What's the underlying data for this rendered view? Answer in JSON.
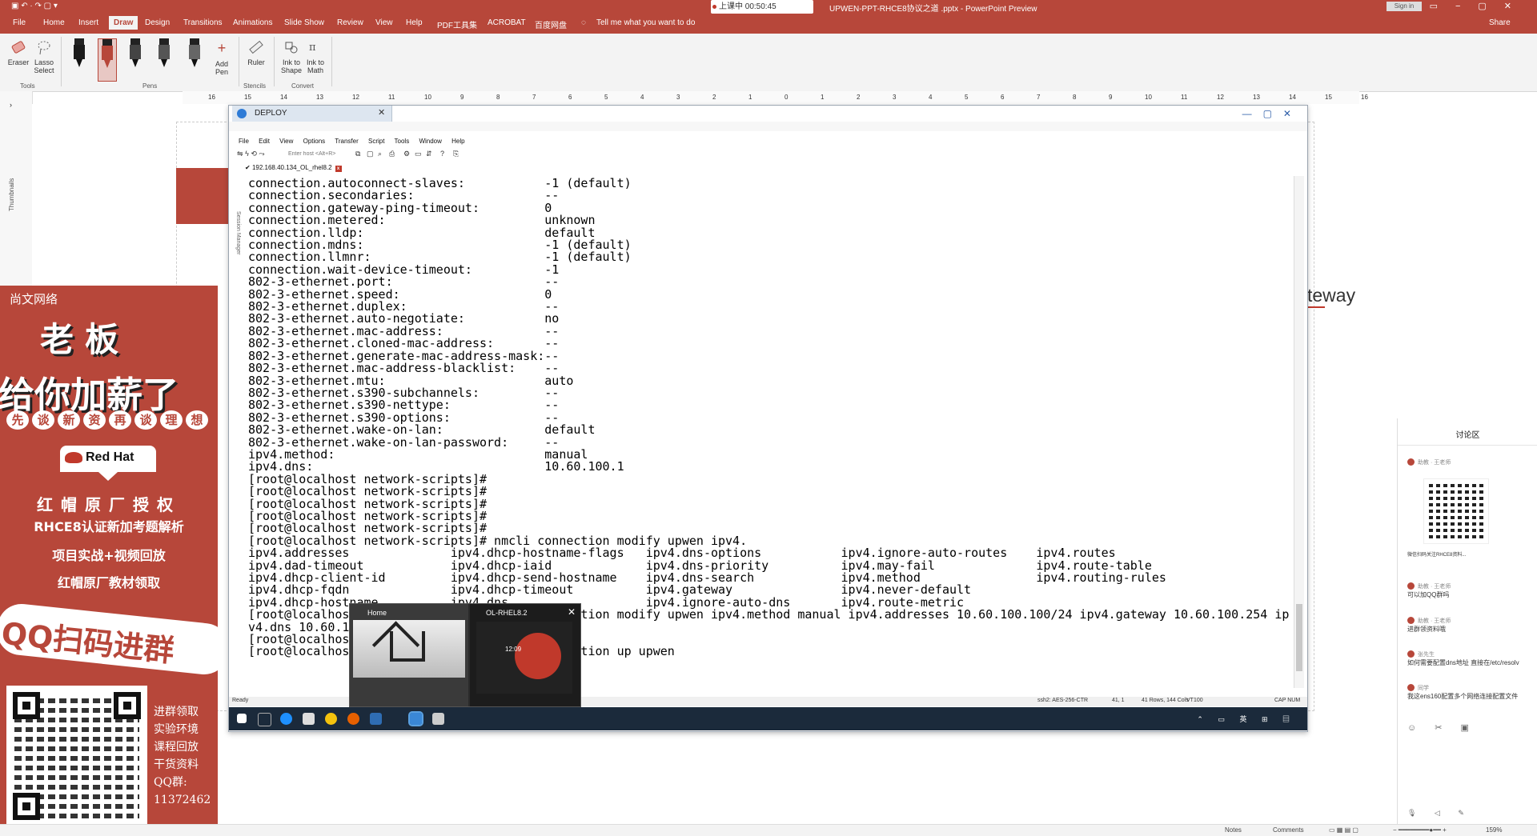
{
  "ppt": {
    "window_title": "UPWEN-PPT-RHCE8协议之道 .pptx - PowerPoint Preview",
    "recording": "上课中 00:50:45",
    "tell_me": "Tell me what you want to do",
    "share": "Share",
    "tabs": [
      "File",
      "Home",
      "Insert",
      "Draw",
      "Design",
      "Transitions",
      "Animations",
      "Slide Show",
      "Review",
      "View",
      "Help",
      "PDF工具集",
      "ACROBAT",
      "百度网盘"
    ],
    "active_tab": "Draw",
    "ribbon": {
      "eraser": "Eraser",
      "lasso": "Lasso Select",
      "tools_group": "Tools",
      "add_pen": "Add Pen",
      "pens_group": "Pens",
      "ruler": "Ruler",
      "stencils_group": "Stencils",
      "ink_to_shape": "Ink to Shape",
      "ink_to_math": "Ink to Math",
      "convert_group": "Convert"
    },
    "ruler_numbers": [
      "16",
      "15",
      "14",
      "13",
      "12",
      "11",
      "10",
      "9",
      "8",
      "7",
      "6",
      "5",
      "4",
      "3",
      "2",
      "1",
      "0",
      "1",
      "2",
      "3",
      "4",
      "5",
      "6",
      "7",
      "8",
      "9",
      "10",
      "11",
      "12",
      "13",
      "14",
      "15",
      "16"
    ],
    "thumbnails_label": "Thumbnails",
    "slide_text": "teway",
    "status": {
      "notes": "Notes",
      "comments": "Comments",
      "zoom": "159%"
    }
  },
  "ad": {
    "brand": "尚文网络",
    "line1": "老板",
    "line2": "给你加薪了",
    "strip": [
      "先",
      "谈",
      "新",
      "资",
      "再",
      "谈",
      "理",
      "想"
    ],
    "redhat": "Red Hat",
    "auth": "红帽原厂授权",
    "l1": "RHCE8认证新加考题解析",
    "l2": "项目实战+视频回放",
    "l3": "红帽原厂教材领取",
    "qq": "QQ扫码进群",
    "side": [
      "进群领取",
      "实验环境",
      "课程回放",
      "干货资料",
      "QQ群:",
      "11372462"
    ]
  },
  "crt": {
    "tab_title": "DEPLOY",
    "menu": [
      "File",
      "Edit",
      "View",
      "Options",
      "Transfer",
      "Script",
      "Tools",
      "Window",
      "Help"
    ],
    "host_placeholder": "Enter host <Alt+R>",
    "session_tab": "192.168.40.134_OL_rhel8.2",
    "session_manager": "Session Manager",
    "terminal_lines": [
      "connection.autoconnect-slaves:           -1 (default)",
      "connection.secondaries:                  --",
      "connection.gateway-ping-timeout:         0",
      "connection.metered:                      unknown",
      "connection.lldp:                         default",
      "connection.mdns:                         -1 (default)",
      "connection.llmnr:                        -1 (default)",
      "connection.wait-device-timeout:          -1",
      "802-3-ethernet.port:                     --",
      "802-3-ethernet.speed:                    0",
      "802-3-ethernet.duplex:                   --",
      "802-3-ethernet.auto-negotiate:           no",
      "802-3-ethernet.mac-address:              --",
      "802-3-ethernet.cloned-mac-address:       --",
      "802-3-ethernet.generate-mac-address-mask:--",
      "802-3-ethernet.mac-address-blacklist:    --",
      "802-3-ethernet.mtu:                      auto",
      "802-3-ethernet.s390-subchannels:         --",
      "802-3-ethernet.s390-nettype:             --",
      "802-3-ethernet.s390-options:             --",
      "802-3-ethernet.wake-on-lan:              default",
      "802-3-ethernet.wake-on-lan-password:     --",
      "ipv4.method:                             manual",
      "ipv4.dns:                                10.60.100.1",
      "[root@localhost network-scripts]#",
      "[root@localhost network-scripts]#",
      "[root@localhost network-scripts]#",
      "[root@localhost network-scripts]#",
      "[root@localhost network-scripts]#",
      "[root@localhost network-scripts]# nmcli connection modify upwen ipv4.",
      "ipv4.addresses              ipv4.dhcp-hostname-flags   ipv4.dns-options           ipv4.ignore-auto-routes    ipv4.routes",
      "ipv4.dad-timeout            ipv4.dhcp-iaid             ipv4.dns-priority          ipv4.may-fail              ipv4.route-table",
      "ipv4.dhcp-client-id         ipv4.dhcp-send-hostname    ipv4.dns-search            ipv4.method                ipv4.routing-rules",
      "ipv4.dhcp-fqdn              ipv4.dhcp-timeout          ipv4.gateway               ipv4.never-default",
      "ipv4.dhcp-hostname          ipv4.dns                   ipv4.ignore-auto-dns       ipv4.route-metric",
      "[root@localhost network-scripts]# nmcli connection modify upwen ipv4.method manual ipv4.addresses 10.60.100.100/24 ipv4.gateway 10.60.100.254 ip",
      "v4.dns 10.60.100.1",
      "[root@localhost network-scripts]#",
      "[root@localhost network-scripts]# nmcli connection up upwen"
    ],
    "status": {
      "ready": "Ready",
      "cipher": "ssh2: AES-256-CTR",
      "pos": "41, 1",
      "size": "41 Rows, 144 Cols",
      "term": "VT100",
      "caps": "CAP  NUM"
    }
  },
  "popup": {
    "home_label": "Home",
    "vm_label": "OL-RHEL8.2",
    "time": "12:09"
  },
  "discussion": {
    "title": "讨论区",
    "messages": [
      {
        "who": "助教 · 王老师",
        "text": ""
      },
      {
        "who": "",
        "text": "微信扫码关注RHCE8资料..."
      },
      {
        "who": "助教 · 王老师",
        "text": "可以加QQ群吗"
      },
      {
        "who": "助教 · 王老师",
        "text": "进群领资料哦"
      },
      {
        "who": "张先生",
        "text": "如何需要配置dns地址 直接在/etc/resolv"
      },
      {
        "who": "同学",
        "text": "我这ens160配置多个网络连接配置文件"
      }
    ]
  },
  "colors": {
    "accent": "#b7473a",
    "taskbar": "#1b2a3b"
  }
}
